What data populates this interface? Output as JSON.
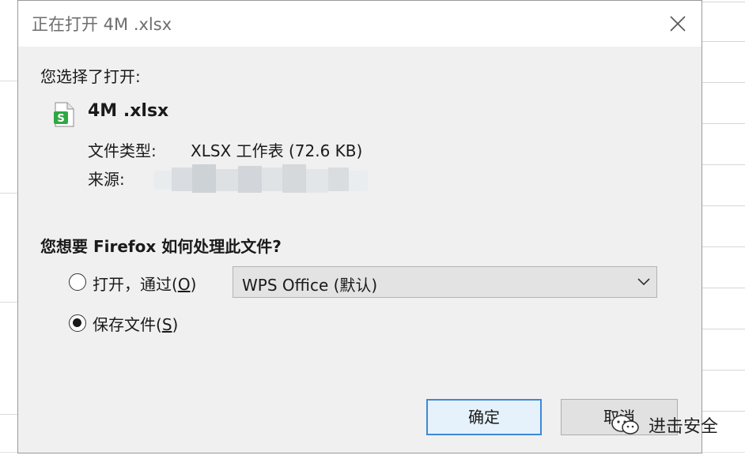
{
  "dialog": {
    "title": "正在打开 4M .xlsx",
    "chose_text": "您选择了打开:",
    "file_name": "4M .xlsx",
    "file_type_label": "文件类型:",
    "file_type_value": "XLSX 工作表 (72.6 KB)",
    "source_label": "来源:",
    "question": "您想要 Firefox 如何处理此文件?",
    "options": {
      "open": {
        "label": "打开，通过(",
        "accel": "O",
        "suffix": ")",
        "selected": false
      },
      "save": {
        "label": "保存文件(",
        "accel": "S",
        "suffix": ")",
        "selected": true
      }
    },
    "app_select": {
      "value": "WPS Office (默认)"
    },
    "buttons": {
      "ok": "确定",
      "cancel": "取消"
    }
  },
  "icons": {
    "close": "close-icon",
    "file": "spreadsheet-file-icon",
    "chevron": "chevron-down-icon",
    "watermark": "wechat-icon"
  },
  "colors": {
    "dialog_bg": "#f0f0f0",
    "title_text": "#6e6e6e",
    "focus_border": "#3c8ad8",
    "file_icon_green": "#2ea843"
  },
  "watermark": {
    "text": "进击安全"
  }
}
